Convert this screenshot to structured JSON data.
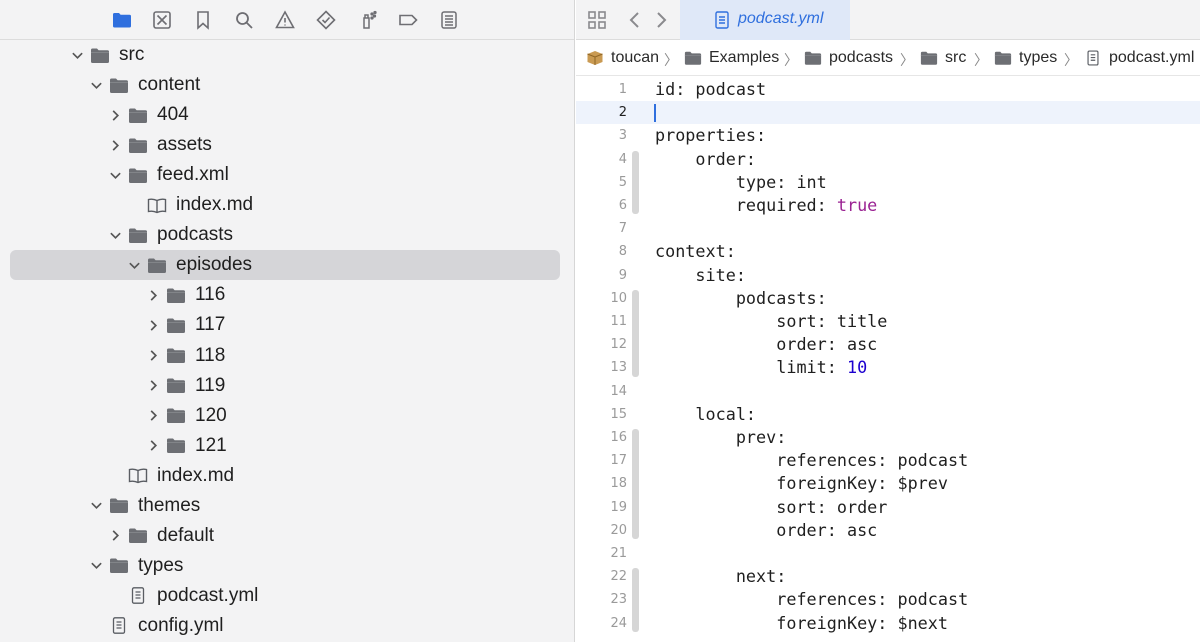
{
  "navigator": {
    "toolbar": [
      {
        "icon": "folder-icon",
        "active": true
      },
      {
        "icon": "source-control-icon",
        "active": false
      },
      {
        "icon": "bookmark-icon",
        "active": false
      },
      {
        "icon": "search-icon",
        "active": false
      },
      {
        "icon": "warning-icon",
        "active": false
      },
      {
        "icon": "test-diamond-icon",
        "active": false
      },
      {
        "icon": "debug-spray-icon",
        "active": false
      },
      {
        "icon": "breakpoint-icon",
        "active": false
      },
      {
        "icon": "report-list-icon",
        "active": false
      }
    ],
    "tree": [
      {
        "label": "src",
        "kind": "folder",
        "depth": 0,
        "expanded": true
      },
      {
        "label": "content",
        "kind": "folder",
        "depth": 1,
        "expanded": true
      },
      {
        "label": "404",
        "kind": "folder",
        "depth": 2,
        "expanded": false
      },
      {
        "label": "assets",
        "kind": "folder",
        "depth": 2,
        "expanded": false
      },
      {
        "label": "feed.xml",
        "kind": "folder",
        "depth": 2,
        "expanded": true
      },
      {
        "label": "index.md",
        "kind": "book",
        "depth": 3
      },
      {
        "label": "podcasts",
        "kind": "folder",
        "depth": 2,
        "expanded": true
      },
      {
        "label": "episodes",
        "kind": "folder",
        "depth": 3,
        "expanded": true,
        "selected": true
      },
      {
        "label": "116",
        "kind": "folder",
        "depth": 4,
        "expanded": false
      },
      {
        "label": "117",
        "kind": "folder",
        "depth": 4,
        "expanded": false
      },
      {
        "label": "118",
        "kind": "folder",
        "depth": 4,
        "expanded": false
      },
      {
        "label": "119",
        "kind": "folder",
        "depth": 4,
        "expanded": false
      },
      {
        "label": "120",
        "kind": "folder",
        "depth": 4,
        "expanded": false
      },
      {
        "label": "121",
        "kind": "folder",
        "depth": 4,
        "expanded": false
      },
      {
        "label": "index.md",
        "kind": "book",
        "depth": 2
      },
      {
        "label": "themes",
        "kind": "folder",
        "depth": 1,
        "expanded": true
      },
      {
        "label": "default",
        "kind": "folder",
        "depth": 2,
        "expanded": false
      },
      {
        "label": "types",
        "kind": "folder",
        "depth": 1,
        "expanded": true
      },
      {
        "label": "podcast.yml",
        "kind": "file",
        "depth": 2
      },
      {
        "label": "config.yml",
        "kind": "file",
        "depth": 1
      }
    ]
  },
  "editor": {
    "tab": {
      "label": "podcast.yml"
    },
    "breadcrumbs": [
      {
        "label": "toucan",
        "icon": "package-icon"
      },
      {
        "label": "Examples",
        "icon": "folder-icon"
      },
      {
        "label": "podcasts",
        "icon": "folder-icon"
      },
      {
        "label": "src",
        "icon": "folder-icon"
      },
      {
        "label": "types",
        "icon": "folder-icon"
      },
      {
        "label": "podcast.yml",
        "icon": "file-icon"
      }
    ],
    "separator": "〉",
    "current_line": 2,
    "lines": [
      {
        "n": "1",
        "segs": [
          [
            "id: podcast",
            ""
          ]
        ]
      },
      {
        "n": "2",
        "segs": [
          [
            "",
            ""
          ]
        ]
      },
      {
        "n": "3",
        "segs": [
          [
            "properties:",
            ""
          ]
        ]
      },
      {
        "n": "4",
        "segs": [
          [
            "    order:",
            ""
          ]
        ]
      },
      {
        "n": "5",
        "segs": [
          [
            "        type: int",
            ""
          ]
        ]
      },
      {
        "n": "6",
        "segs": [
          [
            "        required: ",
            ""
          ],
          [
            "true",
            "kw"
          ]
        ]
      },
      {
        "n": "7",
        "segs": [
          [
            "",
            ""
          ]
        ]
      },
      {
        "n": "8",
        "segs": [
          [
            "context:",
            ""
          ]
        ]
      },
      {
        "n": "9",
        "segs": [
          [
            "    site:",
            ""
          ]
        ]
      },
      {
        "n": "10",
        "segs": [
          [
            "        podcasts:",
            ""
          ]
        ]
      },
      {
        "n": "11",
        "segs": [
          [
            "            sort: title",
            ""
          ]
        ]
      },
      {
        "n": "12",
        "segs": [
          [
            "            order: asc",
            ""
          ]
        ]
      },
      {
        "n": "13",
        "segs": [
          [
            "            limit: ",
            ""
          ],
          [
            "10",
            "num"
          ]
        ]
      },
      {
        "n": "14",
        "segs": [
          [
            "",
            ""
          ]
        ]
      },
      {
        "n": "15",
        "segs": [
          [
            "    local:",
            ""
          ]
        ]
      },
      {
        "n": "16",
        "segs": [
          [
            "        prev:",
            ""
          ]
        ]
      },
      {
        "n": "17",
        "segs": [
          [
            "            references: podcast",
            ""
          ]
        ]
      },
      {
        "n": "18",
        "segs": [
          [
            "            foreignKey: $prev",
            ""
          ]
        ]
      },
      {
        "n": "19",
        "segs": [
          [
            "            sort: order",
            ""
          ]
        ]
      },
      {
        "n": "20",
        "segs": [
          [
            "            order: asc",
            ""
          ]
        ]
      },
      {
        "n": "21",
        "segs": [
          [
            "",
            ""
          ]
        ]
      },
      {
        "n": "22",
        "segs": [
          [
            "        next:",
            ""
          ]
        ]
      },
      {
        "n": "23",
        "segs": [
          [
            "            references: podcast",
            ""
          ]
        ]
      },
      {
        "n": "24",
        "segs": [
          [
            "            foreignKey: $next",
            ""
          ]
        ]
      }
    ]
  }
}
